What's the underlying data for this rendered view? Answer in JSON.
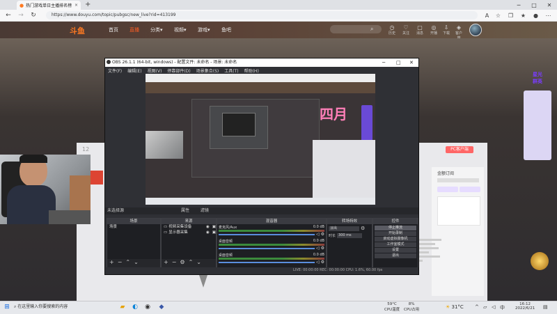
{
  "browser": {
    "tab_title": "热门游戏单日主播排名榜",
    "tab_close": "×",
    "new_tab": "+",
    "url": "https://www.douyu.com/topic/pubgsc/new_live?rid=413199"
  },
  "site": {
    "logo_text": "斗鱼",
    "nav": [
      {
        "label": "首页",
        "active": false
      },
      {
        "label": "直播",
        "active": true
      },
      {
        "label": "分类▾",
        "active": false
      },
      {
        "label": "视频▾",
        "active": false
      },
      {
        "label": "游戏▾",
        "active": false
      },
      {
        "label": "鱼吧",
        "active": false
      }
    ],
    "header_icons": [
      {
        "icon": "history-icon",
        "label": "历史"
      },
      {
        "icon": "follow-icon",
        "label": "关注"
      },
      {
        "icon": "message-icon",
        "label": "消息"
      },
      {
        "icon": "broadcast-icon",
        "label": "开播"
      },
      {
        "icon": "download-icon",
        "label": "下载"
      },
      {
        "icon": "app-icon",
        "label": "客户端"
      }
    ]
  },
  "page": {
    "pc_button": "PC客户端",
    "badge_text": "星光\n群英",
    "number_label": "12",
    "right_panel_title": "金额订阅"
  },
  "obs": {
    "title": "OBS 26.1.1 (64-bit, windows) - 配置文件: 未命名 - 场景: 未命名",
    "menu": [
      "文件(F)",
      "编辑(E)",
      "视图(V)",
      "停靠部件(D)",
      "场景集合(S)",
      "工具(T)",
      "帮助(H)"
    ],
    "scene_bar_label": "未选择源",
    "scene_bar_buttons": [
      "属性",
      "滤镜"
    ],
    "docks": {
      "scenes": {
        "title": "场景",
        "items": [
          "场景"
        ]
      },
      "sources": {
        "title": "来源",
        "items": [
          "视频采集设备",
          "显示器采集"
        ]
      },
      "mixer": {
        "title": "混音器",
        "channels": [
          {
            "name": "麦克风/Aux",
            "db": "0.0 dB"
          },
          {
            "name": "桌面音频",
            "db": "0.0 dB"
          },
          {
            "name": "桌面音频",
            "db": "0.0 dB"
          }
        ]
      },
      "transitions": {
        "title": "转场特效",
        "mode": "淡出",
        "duration_label": "时长",
        "duration": "300 ms"
      },
      "controls": {
        "title": "控件",
        "buttons": [
          "停止推流",
          "开始录制",
          "启动虚拟摄像机",
          "工作室模式",
          "设置",
          "退出"
        ]
      }
    },
    "status": "LIVE: 00:00:00   REC: 00:00:00   CPU: 1.6%, 60.00 fps"
  },
  "taskbar": {
    "search_placeholder": "在这里输入你要搜索的内容",
    "cpu_temp_value": "59°C",
    "cpu_temp_label": "CPU温度",
    "cpu_usage_value": "8%",
    "cpu_usage_label": "CPU占用",
    "weather": "31°C",
    "time": "16:12",
    "date": "2022/6/21"
  }
}
